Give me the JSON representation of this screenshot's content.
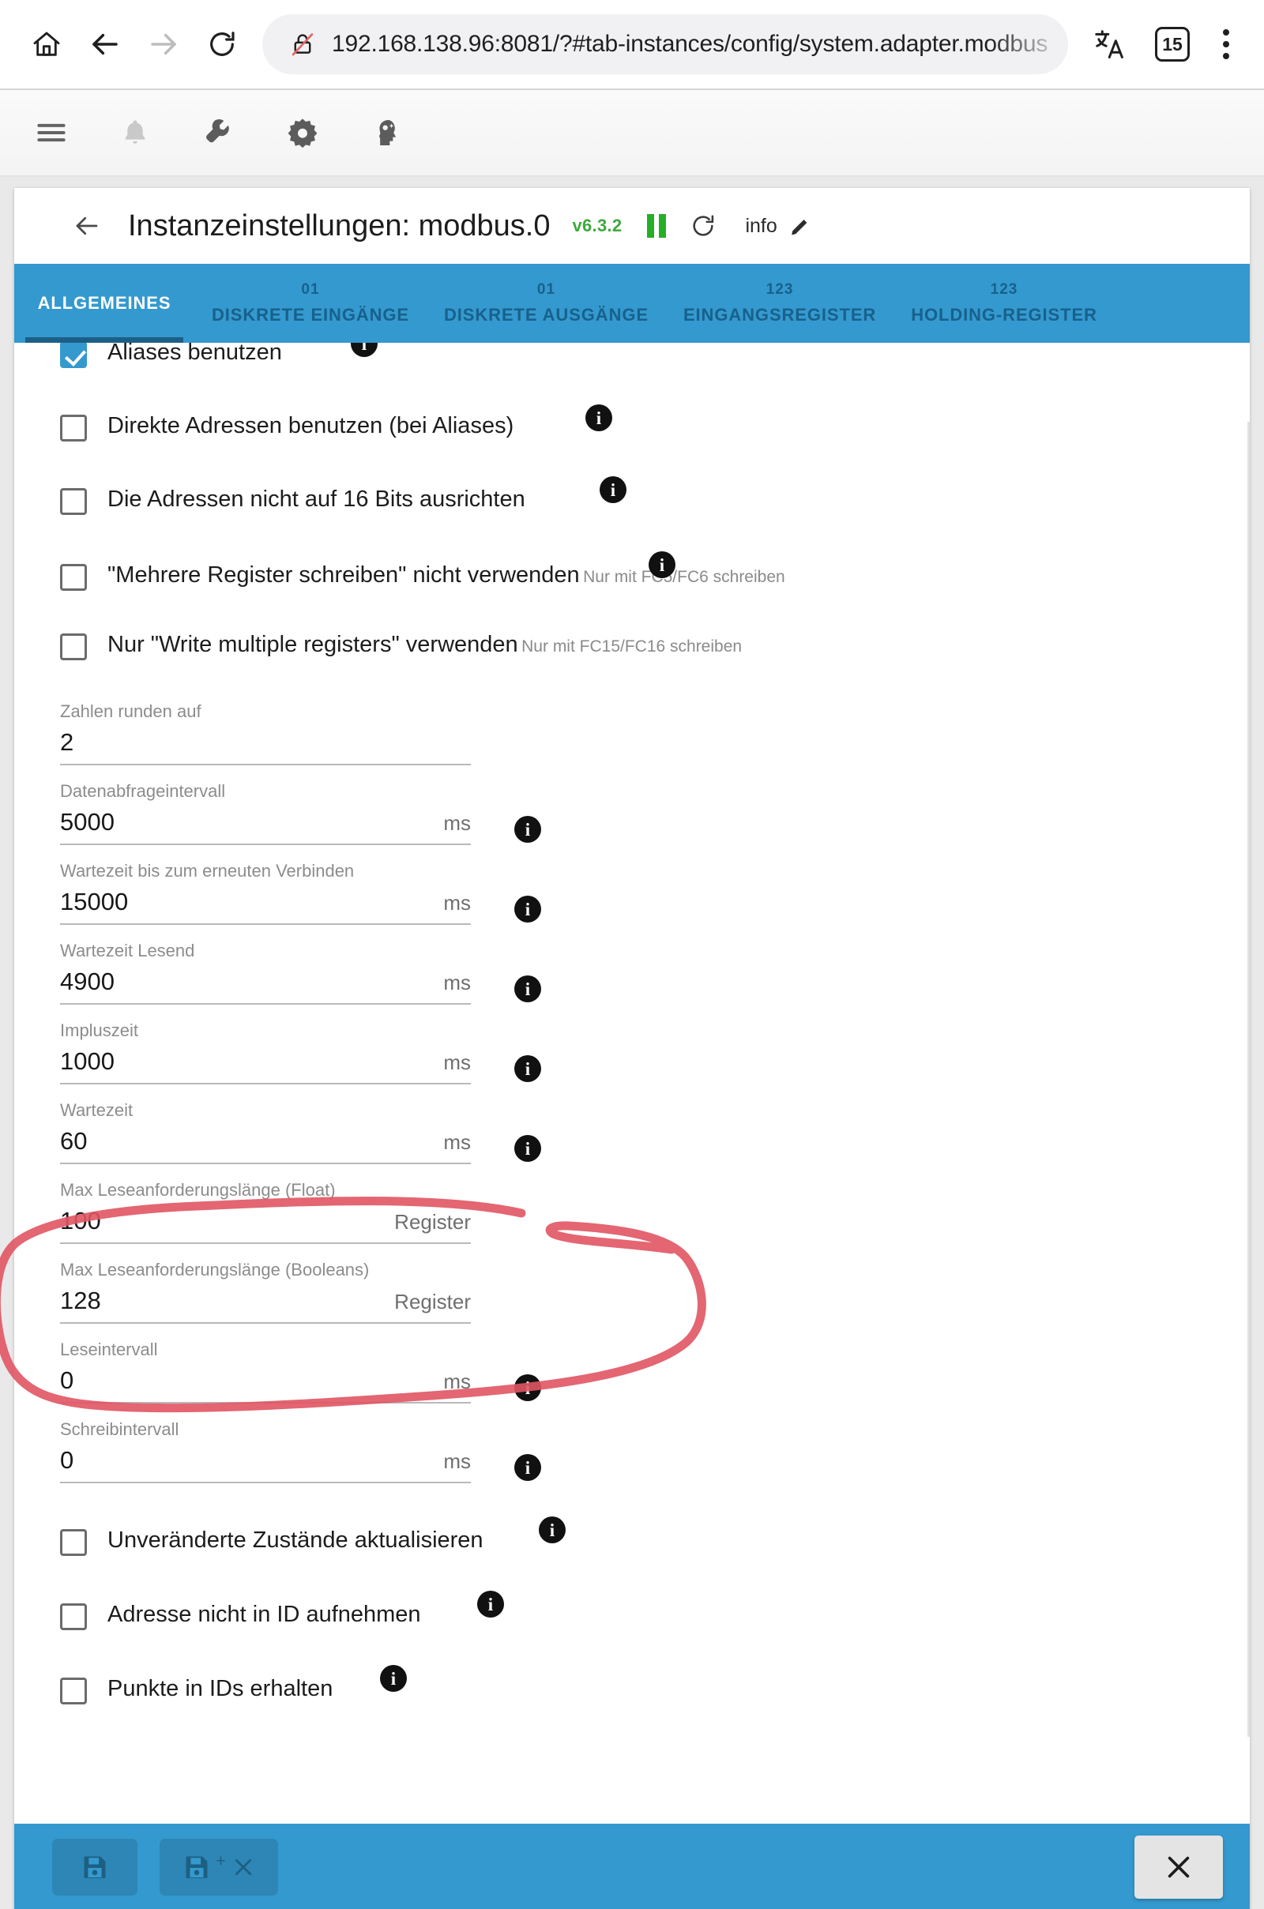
{
  "browser": {
    "url": "192.168.138.96:8081/?#tab-instances/config/system.adapter.modbus",
    "tab_count": "15",
    "icons": {
      "home": "home-icon",
      "back": "back-arrow-icon",
      "forward": "forward-arrow-icon",
      "reload": "reload-icon",
      "not_secure": "not-secure-lock-icon",
      "translate": "translate-icon",
      "menu": "kebab-menu-icon"
    }
  },
  "app_toolbar": {
    "items": [
      {
        "name": "hamburger-menu-icon",
        "label": "Menü"
      },
      {
        "name": "bell-icon",
        "label": "Benachrichtigungen"
      },
      {
        "name": "wrench-icon",
        "label": "Werkzeuge"
      },
      {
        "name": "gear-icon",
        "label": "Einstellungen"
      },
      {
        "name": "expert-head-icon",
        "label": "Expertenmodus"
      }
    ]
  },
  "header": {
    "title": "Instanzeinstellungen: modbus.0",
    "version": "v6.3.2",
    "info_label": "info"
  },
  "tabs": [
    {
      "sup": "",
      "label": "ALLGEMEINES",
      "active": true
    },
    {
      "sup": "01",
      "label": "DISKRETE EINGÄNGE",
      "active": false
    },
    {
      "sup": "01",
      "label": "DISKRETE AUSGÄNGE",
      "active": false
    },
    {
      "sup": "123",
      "label": "EINGANGSREGISTER",
      "active": false
    },
    {
      "sup": "123",
      "label": "HOLDING-REGISTER",
      "active": false
    }
  ],
  "form": {
    "checkboxes_top": [
      {
        "label": "Aliases benutzen",
        "checked": true,
        "sub": "",
        "info": true
      },
      {
        "label": "Direkte Adressen benutzen (bei Aliases)",
        "checked": false,
        "sub": "",
        "info": true
      },
      {
        "label": "Die Adressen nicht auf 16 Bits ausrichten",
        "checked": false,
        "sub": "",
        "info": true
      },
      {
        "label": "\"Mehrere Register schreiben\" nicht verwenden",
        "checked": false,
        "sub": "Nur mit FC5/FC6 schreiben",
        "info": true
      },
      {
        "label": "Nur \"Write multiple registers\" verwenden",
        "checked": false,
        "sub": "Nur mit FC15/FC16 schreiben",
        "info": false
      }
    ],
    "fields": [
      {
        "label": "Zahlen runden auf",
        "value": "2",
        "unit": "",
        "info": false
      },
      {
        "label": "Datenabfrageintervall",
        "value": "5000",
        "unit": "ms",
        "info": true
      },
      {
        "label": "Wartezeit bis zum erneuten Verbinden",
        "value": "15000",
        "unit": "ms",
        "info": true
      },
      {
        "label": "Wartezeit Lesend",
        "value": "4900",
        "unit": "ms",
        "info": true
      },
      {
        "label": "Impluszeit",
        "value": "1000",
        "unit": "ms",
        "info": true
      },
      {
        "label": "Wartezeit",
        "value": "60",
        "unit": "ms",
        "info": true
      },
      {
        "label": "Max Leseanforderungslänge (Float)",
        "value": "100",
        "unit": "Register",
        "info": false
      },
      {
        "label": "Max Leseanforderungslänge (Booleans)",
        "value": "128",
        "unit": "Register",
        "info": false
      },
      {
        "label": "Leseintervall",
        "value": "0",
        "unit": "ms",
        "info": true
      },
      {
        "label": "Schreibintervall",
        "value": "0",
        "unit": "ms",
        "info": true
      }
    ],
    "checkboxes_bottom": [
      {
        "label": "Unveränderte Zustände aktualisieren",
        "checked": false,
        "info": true
      },
      {
        "label": "Adresse nicht in ID aufnehmen",
        "checked": false,
        "info": true
      },
      {
        "label": "Punkte in IDs erhalten",
        "checked": false,
        "info": true
      }
    ]
  },
  "bottom_bar": {
    "save": "save-icon",
    "save_close": "save-and-close-icon",
    "close": "close-icon"
  },
  "annotation": {
    "type": "hand-drawn-circle",
    "color": "#e05563",
    "targets": [
      "Max Leseanforderungslänge (Float)",
      "Max Leseanforderungslänge (Booleans)"
    ]
  },
  "colors": {
    "accent_blue": "#3499ce",
    "tab_inactive": "#17618c",
    "active_indicator": "#1c5f86",
    "version_green": "#3ea93e",
    "annotation_red": "#e05563"
  }
}
